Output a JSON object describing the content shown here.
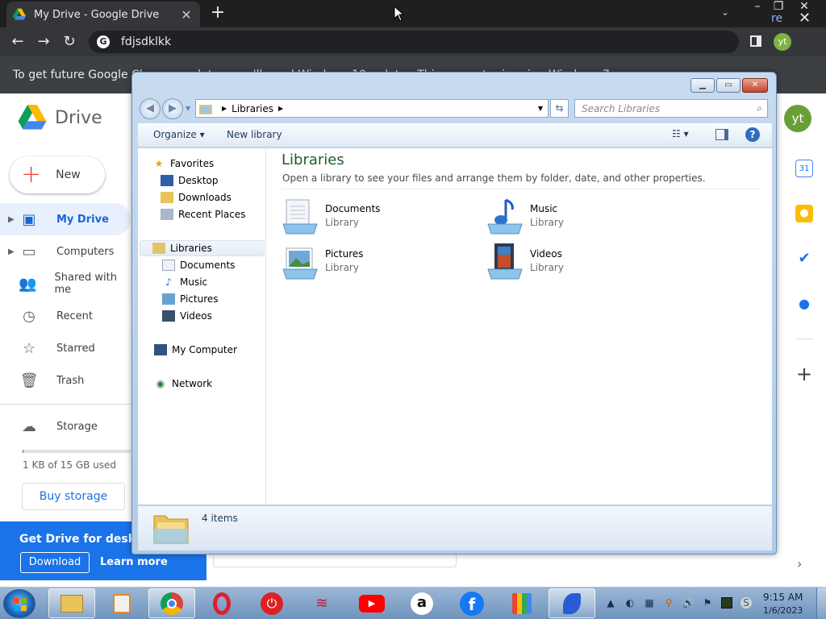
{
  "chrome": {
    "tab_title": "My Drive - Google Drive",
    "url": "fdjsdklkk",
    "profile_initials": "yt",
    "infobar_text": "To get future Google Chrome updates, you'll need Windows 10 or later. This computer is using Windows 7.",
    "infobar_link": "re"
  },
  "drive": {
    "logo_text": "Drive",
    "new_label": "New",
    "nav": [
      {
        "label": "My Drive",
        "icon": "my-drive-icon"
      },
      {
        "label": "Computers",
        "icon": "computers-icon"
      },
      {
        "label": "Shared with me",
        "icon": "shared-icon"
      },
      {
        "label": "Recent",
        "icon": "clock-icon"
      },
      {
        "label": "Starred",
        "icon": "star-icon"
      },
      {
        "label": "Trash",
        "icon": "trash-icon"
      }
    ],
    "storage_label": "Storage",
    "storage_used_text": "1 KB of 15 GB used",
    "storage_used_fraction": 0.0001,
    "buy_storage_label": "Buy storage",
    "banner_title": "Get Drive for desktop",
    "banner_download": "Download",
    "banner_learn_more": "Learn more",
    "account_initials": "yt",
    "accent_color": "#1a73e8"
  },
  "explorer": {
    "address_segment": "Libraries",
    "search_placeholder": "Search Libraries",
    "toolbar": {
      "organize": "Organize",
      "new_library": "New library"
    },
    "navpane": [
      {
        "label": "Favorites",
        "icon": "star-icon"
      },
      {
        "label": "Desktop",
        "icon": "desktop-icon"
      },
      {
        "label": "Downloads",
        "icon": "downloads-folder-icon"
      },
      {
        "label": "Recent Places",
        "icon": "recent-places-icon"
      },
      {
        "label": "Libraries",
        "icon": "libraries-icon"
      },
      {
        "label": "Documents",
        "icon": "documents-icon"
      },
      {
        "label": "Music",
        "icon": "music-note-icon"
      },
      {
        "label": "Pictures",
        "icon": "pictures-icon"
      },
      {
        "label": "Videos",
        "icon": "videos-icon"
      },
      {
        "label": "My Computer",
        "icon": "computer-icon"
      },
      {
        "label": "Network",
        "icon": "network-icon"
      }
    ],
    "content_title": "Libraries",
    "content_subtitle": "Open a library to see your files and arrange them by folder, date, and other properties.",
    "libraries": [
      {
        "name": "Documents",
        "kind": "Library",
        "icon": "documents-library-icon"
      },
      {
        "name": "Music",
        "kind": "Library",
        "icon": "music-library-icon"
      },
      {
        "name": "Pictures",
        "kind": "Library",
        "icon": "pictures-library-icon"
      },
      {
        "name": "Videos",
        "kind": "Library",
        "icon": "videos-library-icon"
      }
    ],
    "status_text": "4 items"
  },
  "taskbar": {
    "time": "9:15 AM",
    "date": "1/6/2023",
    "apps": [
      "file-explorer-icon",
      "media-player-icon",
      "chrome-icon",
      "opera-icon",
      "power-icon",
      "bank-icon",
      "youtube-icon",
      "amazon-icon",
      "facebook-icon",
      "shopping-bag-icon",
      "bird-app-icon"
    ]
  }
}
